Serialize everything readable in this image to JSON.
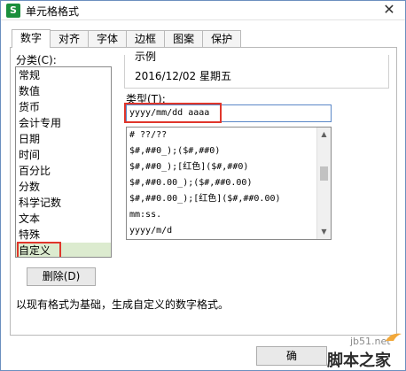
{
  "window": {
    "title": "单元格格式",
    "app_icon_letter": "S",
    "close_glyph": "✕"
  },
  "tabs": [
    {
      "label": "数字",
      "active": true
    },
    {
      "label": "对齐",
      "active": false
    },
    {
      "label": "字体",
      "active": false
    },
    {
      "label": "边框",
      "active": false
    },
    {
      "label": "图案",
      "active": false
    },
    {
      "label": "保护",
      "active": false
    }
  ],
  "category": {
    "label": "分类(C):",
    "items": [
      "常规",
      "数值",
      "货币",
      "会计专用",
      "日期",
      "时间",
      "百分比",
      "分数",
      "科学记数",
      "文本",
      "特殊",
      "自定义"
    ],
    "selected": "自定义"
  },
  "sample": {
    "label": "示例",
    "value": "2016/12/02 星期五"
  },
  "type": {
    "label": "类型(T):",
    "value": "yyyy/mm/dd aaaa"
  },
  "format_list": {
    "items": [
      "# ??/??",
      "$#,##0_);($#,##0)",
      "$#,##0_);[红色]($#,##0)",
      "$#,##0.00_);($#,##0.00)",
      "$#,##0.00_);[红色]($#,##0.00)",
      "mm:ss.",
      "yyyy/m/d"
    ],
    "scroll_up_glyph": "▲",
    "scroll_down_glyph": "▼"
  },
  "buttons": {
    "delete_label": "删除(D)",
    "ok_label": "确"
  },
  "description": "以现有格式为基础，生成自定义的数字格式。",
  "watermark": {
    "line1": "jb51.net",
    "line2": "脚本之家"
  },
  "colors": {
    "highlight_red": "#e0362b",
    "selected_bg": "#dcebcf",
    "input_border": "#5a87c7"
  }
}
